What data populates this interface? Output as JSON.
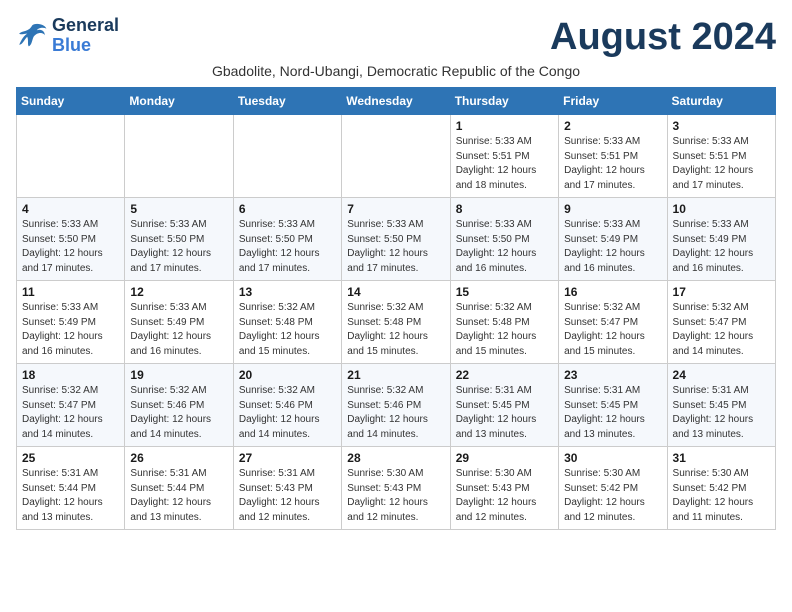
{
  "logo": {
    "line1": "General",
    "line2": "Blue"
  },
  "month_title": "August 2024",
  "subtitle": "Gbadolite, Nord-Ubangi, Democratic Republic of the Congo",
  "headers": [
    "Sunday",
    "Monday",
    "Tuesday",
    "Wednesday",
    "Thursday",
    "Friday",
    "Saturday"
  ],
  "weeks": [
    [
      {
        "day": "",
        "info": ""
      },
      {
        "day": "",
        "info": ""
      },
      {
        "day": "",
        "info": ""
      },
      {
        "day": "",
        "info": ""
      },
      {
        "day": "1",
        "info": "Sunrise: 5:33 AM\nSunset: 5:51 PM\nDaylight: 12 hours\nand 18 minutes."
      },
      {
        "day": "2",
        "info": "Sunrise: 5:33 AM\nSunset: 5:51 PM\nDaylight: 12 hours\nand 17 minutes."
      },
      {
        "day": "3",
        "info": "Sunrise: 5:33 AM\nSunset: 5:51 PM\nDaylight: 12 hours\nand 17 minutes."
      }
    ],
    [
      {
        "day": "4",
        "info": "Sunrise: 5:33 AM\nSunset: 5:50 PM\nDaylight: 12 hours\nand 17 minutes."
      },
      {
        "day": "5",
        "info": "Sunrise: 5:33 AM\nSunset: 5:50 PM\nDaylight: 12 hours\nand 17 minutes."
      },
      {
        "day": "6",
        "info": "Sunrise: 5:33 AM\nSunset: 5:50 PM\nDaylight: 12 hours\nand 17 minutes."
      },
      {
        "day": "7",
        "info": "Sunrise: 5:33 AM\nSunset: 5:50 PM\nDaylight: 12 hours\nand 17 minutes."
      },
      {
        "day": "8",
        "info": "Sunrise: 5:33 AM\nSunset: 5:50 PM\nDaylight: 12 hours\nand 16 minutes."
      },
      {
        "day": "9",
        "info": "Sunrise: 5:33 AM\nSunset: 5:49 PM\nDaylight: 12 hours\nand 16 minutes."
      },
      {
        "day": "10",
        "info": "Sunrise: 5:33 AM\nSunset: 5:49 PM\nDaylight: 12 hours\nand 16 minutes."
      }
    ],
    [
      {
        "day": "11",
        "info": "Sunrise: 5:33 AM\nSunset: 5:49 PM\nDaylight: 12 hours\nand 16 minutes."
      },
      {
        "day": "12",
        "info": "Sunrise: 5:33 AM\nSunset: 5:49 PM\nDaylight: 12 hours\nand 16 minutes."
      },
      {
        "day": "13",
        "info": "Sunrise: 5:32 AM\nSunset: 5:48 PM\nDaylight: 12 hours\nand 15 minutes."
      },
      {
        "day": "14",
        "info": "Sunrise: 5:32 AM\nSunset: 5:48 PM\nDaylight: 12 hours\nand 15 minutes."
      },
      {
        "day": "15",
        "info": "Sunrise: 5:32 AM\nSunset: 5:48 PM\nDaylight: 12 hours\nand 15 minutes."
      },
      {
        "day": "16",
        "info": "Sunrise: 5:32 AM\nSunset: 5:47 PM\nDaylight: 12 hours\nand 15 minutes."
      },
      {
        "day": "17",
        "info": "Sunrise: 5:32 AM\nSunset: 5:47 PM\nDaylight: 12 hours\nand 14 minutes."
      }
    ],
    [
      {
        "day": "18",
        "info": "Sunrise: 5:32 AM\nSunset: 5:47 PM\nDaylight: 12 hours\nand 14 minutes."
      },
      {
        "day": "19",
        "info": "Sunrise: 5:32 AM\nSunset: 5:46 PM\nDaylight: 12 hours\nand 14 minutes."
      },
      {
        "day": "20",
        "info": "Sunrise: 5:32 AM\nSunset: 5:46 PM\nDaylight: 12 hours\nand 14 minutes."
      },
      {
        "day": "21",
        "info": "Sunrise: 5:32 AM\nSunset: 5:46 PM\nDaylight: 12 hours\nand 14 minutes."
      },
      {
        "day": "22",
        "info": "Sunrise: 5:31 AM\nSunset: 5:45 PM\nDaylight: 12 hours\nand 13 minutes."
      },
      {
        "day": "23",
        "info": "Sunrise: 5:31 AM\nSunset: 5:45 PM\nDaylight: 12 hours\nand 13 minutes."
      },
      {
        "day": "24",
        "info": "Sunrise: 5:31 AM\nSunset: 5:45 PM\nDaylight: 12 hours\nand 13 minutes."
      }
    ],
    [
      {
        "day": "25",
        "info": "Sunrise: 5:31 AM\nSunset: 5:44 PM\nDaylight: 12 hours\nand 13 minutes."
      },
      {
        "day": "26",
        "info": "Sunrise: 5:31 AM\nSunset: 5:44 PM\nDaylight: 12 hours\nand 13 minutes."
      },
      {
        "day": "27",
        "info": "Sunrise: 5:31 AM\nSunset: 5:43 PM\nDaylight: 12 hours\nand 12 minutes."
      },
      {
        "day": "28",
        "info": "Sunrise: 5:30 AM\nSunset: 5:43 PM\nDaylight: 12 hours\nand 12 minutes."
      },
      {
        "day": "29",
        "info": "Sunrise: 5:30 AM\nSunset: 5:43 PM\nDaylight: 12 hours\nand 12 minutes."
      },
      {
        "day": "30",
        "info": "Sunrise: 5:30 AM\nSunset: 5:42 PM\nDaylight: 12 hours\nand 12 minutes."
      },
      {
        "day": "31",
        "info": "Sunrise: 5:30 AM\nSunset: 5:42 PM\nDaylight: 12 hours\nand 11 minutes."
      }
    ]
  ]
}
